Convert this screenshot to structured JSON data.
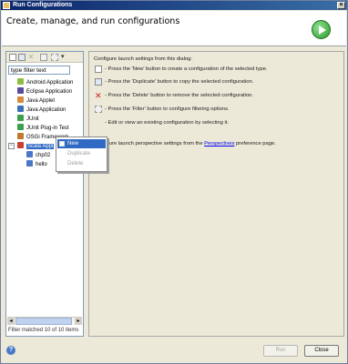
{
  "window": {
    "title": "Run Configurations",
    "close_glyph": "×"
  },
  "banner": {
    "title": "Create, manage, and run configurations",
    "icon": "run-icon"
  },
  "toolbar": {
    "buttons": [
      {
        "name": "new-launch-configuration",
        "icon": "new-config-icon"
      },
      {
        "name": "duplicate",
        "icon": "duplicate-icon"
      },
      {
        "name": "delete",
        "icon": "delete-icon",
        "glyph": "✕"
      },
      {
        "name": "collapse-all",
        "icon": "collapse-all-icon"
      },
      {
        "name": "filter",
        "icon": "filter-icon"
      },
      {
        "name": "view-menu",
        "icon": "dropdown-menu-icon",
        "glyph": "▾"
      }
    ]
  },
  "filter": {
    "placeholder": "type filter text",
    "value": "type filter text"
  },
  "tree": {
    "items": [
      {
        "label": "Android Application",
        "icon": "android-icon",
        "color": "#8cbf3f"
      },
      {
        "label": "Eclipse Application",
        "icon": "eclipse-icon",
        "color": "#5b4a9e"
      },
      {
        "label": "Java Applet",
        "icon": "applet-icon",
        "color": "#d98c3a"
      },
      {
        "label": "Java Application",
        "icon": "java-app-icon",
        "color": "#3a6fb8"
      },
      {
        "label": "JUnit",
        "icon": "junit-icon",
        "color": "#3aa04a"
      },
      {
        "label": "JUnit Plug-in Test",
        "icon": "junit-plugin-icon",
        "color": "#3aa04a"
      },
      {
        "label": "OSGi Framework",
        "icon": "osgi-icon",
        "color": "#c07a30"
      },
      {
        "label": "Scala Appl",
        "icon": "scala-icon",
        "color": "#c84030",
        "expanded": true,
        "selected": true
      },
      {
        "label": "chp02",
        "icon": "scala-config-icon",
        "color": "#4a78c8",
        "child": true
      },
      {
        "label": "hello",
        "icon": "scala-config-icon",
        "color": "#4a78c8",
        "child": true
      }
    ]
  },
  "status": "Filter matched 10 of 10 items",
  "context_menu": {
    "items": [
      {
        "label": "New",
        "enabled": true
      },
      {
        "label": "Duplicate",
        "enabled": false
      },
      {
        "label": "Delete",
        "enabled": false
      }
    ]
  },
  "right_panel": {
    "intro": "Configure launch settings from this dialog:",
    "lines": [
      {
        "text": "- Press the 'New' button to create a configuration of the selected type.",
        "icon": "new-config-icon"
      },
      {
        "text": "- Press the 'Duplicate' button to copy the selected configuration.",
        "icon": "duplicate-icon"
      },
      {
        "text": "- Press the 'Delete' button to remove the selected configuration.",
        "icon": "delete-icon"
      },
      {
        "text": "- Press the 'Filter' button to configure filtering options.",
        "icon": "filter-icon"
      },
      {
        "text": "- Edit or view an existing configuration by selecting it.",
        "icon": ""
      }
    ],
    "perspective_prefix": "Configure launch perspective settings from the ",
    "perspective_link": "Perspectives",
    "perspective_suffix": " preference page."
  },
  "buttons": {
    "run": "Run",
    "close": "Close",
    "help": "?"
  },
  "colors": {
    "selection": "#316ac5",
    "title_bar": "#0a246a",
    "background": "#ece9d8"
  }
}
